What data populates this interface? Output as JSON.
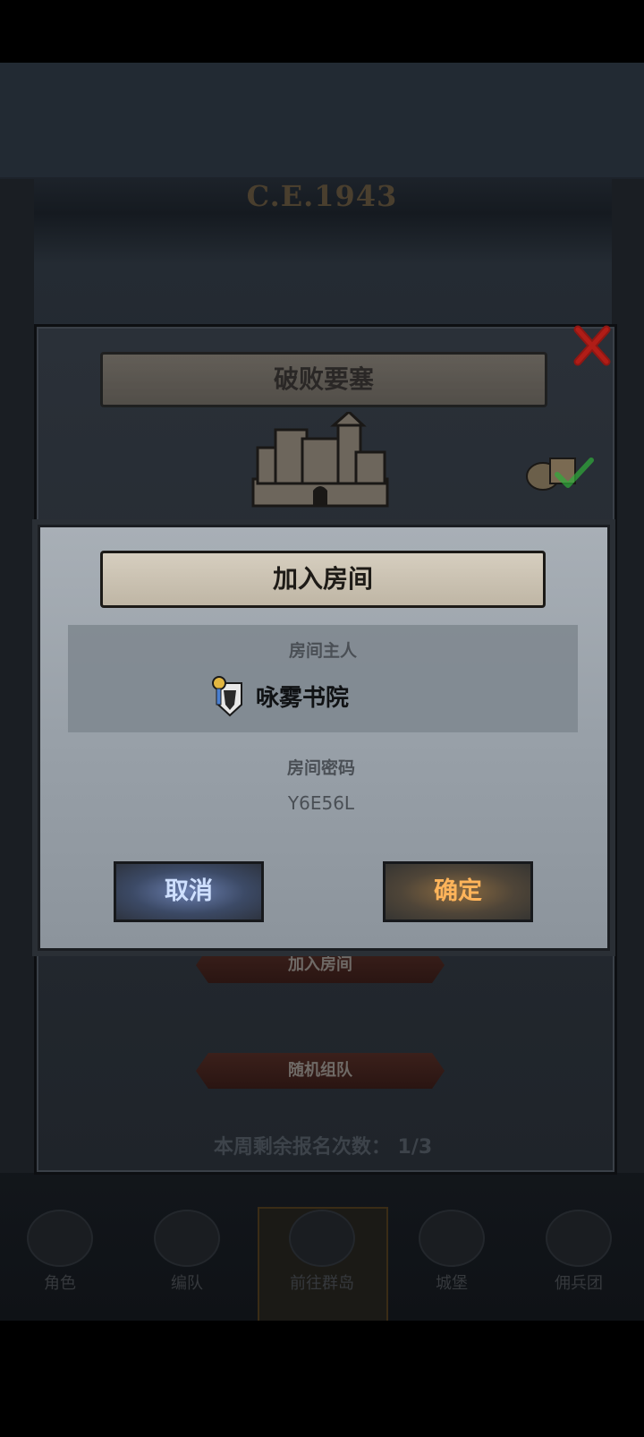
{
  "background": {
    "era_text": "C.E.1943",
    "nav": [
      "角色",
      "编队",
      "前往群岛",
      "城堡",
      "佣兵团"
    ]
  },
  "outer_modal": {
    "title": "破败要塞",
    "join_room_button": "加入房间",
    "random_team_button": "随机组队",
    "remaining_label": "本周剩余报名次数：",
    "remaining_value": "1/3"
  },
  "dialog": {
    "title": "加入房间",
    "host_label": "房间主人",
    "host_name": "咏雾书院",
    "password_label": "房间密码",
    "password_value": "Y6E56L",
    "cancel_button": "取消",
    "ok_button": "确定"
  },
  "icons": [
    "castle-icon",
    "loot-bag-icon",
    "check-icon",
    "close-icon",
    "guild-emblem-icon"
  ],
  "colors": {
    "cancel_glow": "#5e7bd0",
    "ok_glow": "#e08a2e",
    "close_red": "#c0201a",
    "check_green": "#2fae3a"
  }
}
